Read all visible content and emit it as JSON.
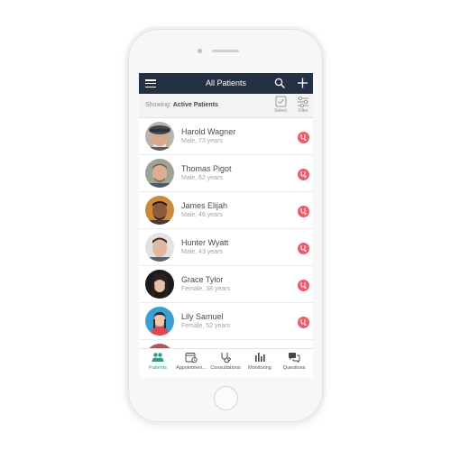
{
  "header": {
    "title": "All Patients"
  },
  "filter": {
    "showing_label": "Showing:",
    "showing_value": "Active Patients",
    "select_label": "Select",
    "filter_label": "Filter"
  },
  "patients": [
    {
      "name": "Harold Wagner",
      "details": "Male, 73 years"
    },
    {
      "name": "Thomas Pigot",
      "details": "Male, 62 years"
    },
    {
      "name": "James Elijah",
      "details": "Male, 46 years"
    },
    {
      "name": "Hunter Wyatt",
      "details": "Male, 43 years"
    },
    {
      "name": "Grace Tylor",
      "details": "Female, 38 years"
    },
    {
      "name": "Lily Samuel",
      "details": "Female, 52 years"
    }
  ],
  "tabs": [
    {
      "label": "Patients",
      "icon": "patients-icon",
      "active": true
    },
    {
      "label": "Appointmen...",
      "icon": "calendar-icon",
      "active": false
    },
    {
      "label": "Consultations",
      "icon": "stethoscope-icon",
      "active": false
    },
    {
      "label": "Monitoring",
      "icon": "bar-chart-icon",
      "active": false
    },
    {
      "label": "Questions",
      "icon": "chat-icon",
      "active": false
    }
  ],
  "colors": {
    "header_bg": "#243044",
    "status_red": "#ef5b6a",
    "active_tab": "#2aa08a"
  }
}
